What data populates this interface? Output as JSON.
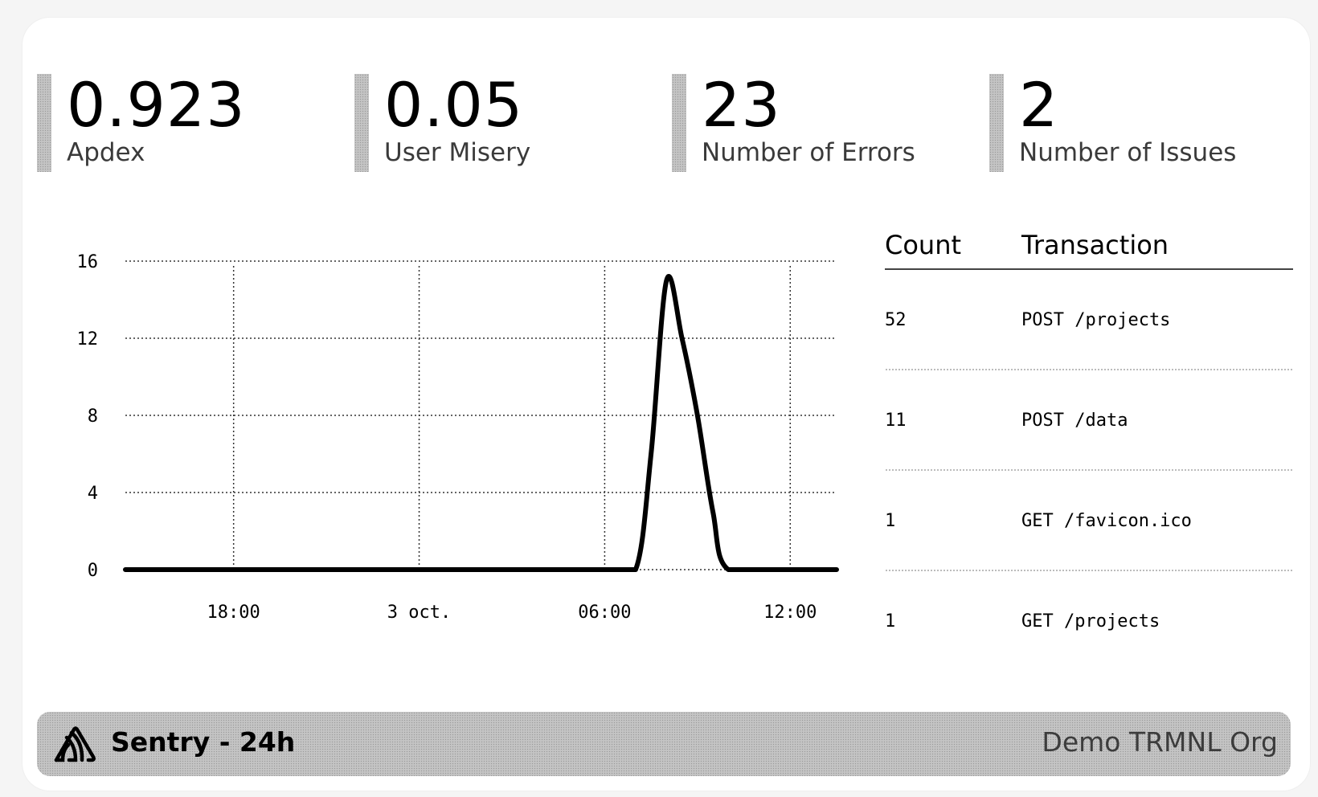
{
  "metrics": [
    {
      "value": "0.923",
      "label": "Apdex"
    },
    {
      "value": "0.05",
      "label": "User Misery"
    },
    {
      "value": "23",
      "label": "Number of Errors"
    },
    {
      "value": "2",
      "label": "Number of Issues"
    }
  ],
  "chart_data": {
    "type": "line",
    "title": "",
    "xlabel": "",
    "ylabel": "",
    "ylim": [
      0,
      16
    ],
    "y_ticks": [
      "0",
      "4",
      "8",
      "12",
      "16"
    ],
    "x_ticks": [
      "18:00",
      "3 oct.",
      "06:00",
      "12:00"
    ],
    "grid": true,
    "series": [
      {
        "x": [
          "2 oct. 14:30",
          "2 oct. 18:00",
          "3 oct. 00:00",
          "3 oct. 06:00",
          "3 oct. 07:00",
          "3 oct. 07:30",
          "3 oct. 08:00",
          "3 oct. 08:30",
          "3 oct. 09:00",
          "3 oct. 09:30",
          "3 oct. 10:00",
          "3 oct. 12:00",
          "3 oct. 13:30"
        ],
        "values": [
          0,
          0,
          0,
          0,
          0,
          6,
          15,
          12,
          8,
          3,
          0,
          0,
          0
        ]
      }
    ]
  },
  "table": {
    "headers": {
      "count": "Count",
      "transaction": "Transaction"
    },
    "rows": [
      {
        "count": "52",
        "transaction": "POST /projects"
      },
      {
        "count": "11",
        "transaction": "POST /data"
      },
      {
        "count": "1",
        "transaction": "GET /favicon.ico"
      },
      {
        "count": "1",
        "transaction": "GET /projects"
      }
    ]
  },
  "footer": {
    "logo_icon": "sentry-logo-icon",
    "title": "Sentry - 24h",
    "org": "Demo TRMNL Org"
  }
}
